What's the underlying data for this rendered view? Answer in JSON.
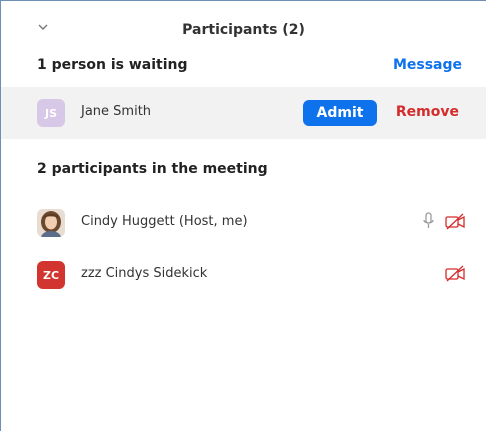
{
  "panel": {
    "title": "Participants (2)"
  },
  "waiting": {
    "heading": "1 person is waiting",
    "message_label": "Message",
    "person": {
      "initials": "JS",
      "name": "Jane Smith",
      "avatar_color": "#d8c8e8",
      "initials_color": "#ffffff"
    },
    "admit_label": "Admit",
    "remove_label": "Remove"
  },
  "meeting": {
    "heading": "2 participants in the meeting",
    "participants": [
      {
        "name": "Cindy Huggett (Host, me)",
        "avatar": "photo",
        "icons": [
          "microphone-icon",
          "video-off-icon"
        ]
      },
      {
        "name": "zzz Cindys Sidekick",
        "initials": "ZC",
        "avatar_color": "#d2342f",
        "initials_color": "#ffffff",
        "icons": [
          "video-off-icon"
        ]
      }
    ]
  },
  "colors": {
    "accent": "#0e72ed",
    "danger": "#d52b2b",
    "muted_icon": "#9b9b9b",
    "video_off": "#d52b2b"
  }
}
